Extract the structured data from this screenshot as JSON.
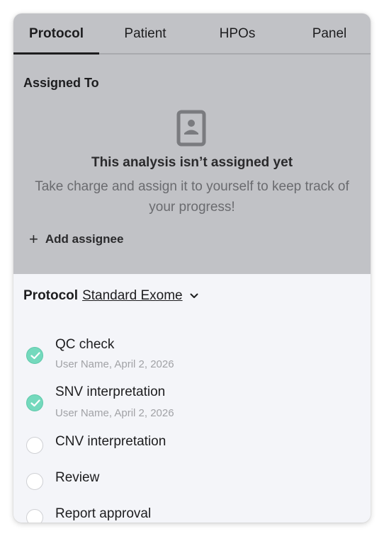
{
  "tabs": [
    {
      "label": "Protocol",
      "active": true
    },
    {
      "label": "Patient",
      "active": false
    },
    {
      "label": "HPOs",
      "active": false
    },
    {
      "label": "Panel",
      "active": false
    }
  ],
  "assigned": {
    "title": "Assigned To",
    "icon": "badge-icon",
    "empty_title": "This analysis isn’t assigned yet",
    "empty_desc": "Take charge and assign it to yourself to keep track of your progress!",
    "add_label": "Add assignee"
  },
  "protocol": {
    "label": "Protocol",
    "value": "Standard Exome",
    "steps": [
      {
        "name": "QC check",
        "meta": "User Name, April 2, 2026",
        "done": true
      },
      {
        "name": "SNV interpretation",
        "meta": "User Name, April 2, 2026",
        "done": true
      },
      {
        "name": "CNV interpretation",
        "done": false
      },
      {
        "name": "Review",
        "done": false
      },
      {
        "name": "Report approval",
        "done": false
      }
    ]
  },
  "colors": {
    "overlay": "#c1c2c6",
    "panel_bg": "#f4f5f9",
    "done_green": "#74d9bd",
    "text_dark": "#1d1d1f",
    "text_muted": "#a1a2a6"
  }
}
